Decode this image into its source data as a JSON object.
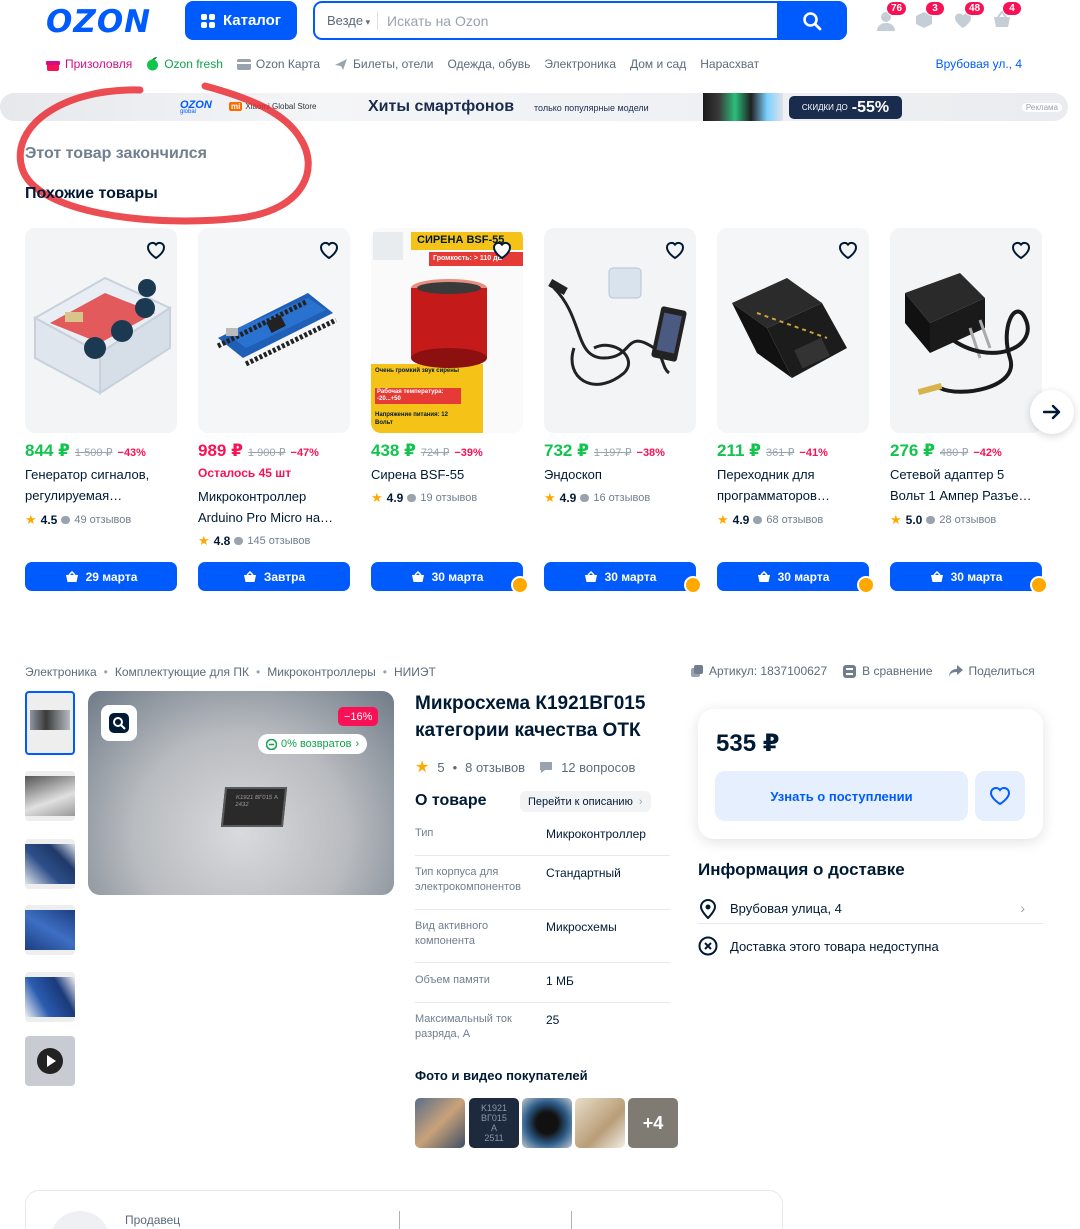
{
  "header": {
    "logo": "OZON",
    "catalog_label": "Каталог",
    "search_scope": "Везде",
    "search_placeholder": "Искать на Ozon",
    "badges": {
      "profile": "76",
      "orders": "3",
      "favorites": "48",
      "cart": "4"
    }
  },
  "nav": {
    "items": [
      "Призоловля",
      "Ozon fresh",
      "Ozon Карта",
      "Билеты, отели",
      "Одежда, обувь",
      "Электроника",
      "Дом и сад",
      "Нарасхват"
    ],
    "address": "Врубовая ул., 4"
  },
  "banner": {
    "brand": "OZON",
    "brand_sub": "global",
    "store": "Xiaomi Global Store",
    "title": "Хиты смартфонов",
    "subtitle": "только популярные модели",
    "discount_prefix": "СКИДКИ ДО",
    "discount_value": "-55%",
    "ad_label": "Реклама"
  },
  "page": {
    "out_of_stock": "Этот товар закончился",
    "similar_title": "Похожие товары"
  },
  "cards": [
    {
      "price": "844 ₽",
      "old_price": "1 500 ₽",
      "discount": "−43%",
      "name": "Генератор сигналов, регулируемая…",
      "rating": "4.5",
      "reviews": "49 отзывов",
      "delivery": "29 марта",
      "price_color": "#10c44c"
    },
    {
      "price": "989 ₽",
      "old_price": "1 900 ₽",
      "discount": "−47%",
      "note": "Осталось 45 шт",
      "name": "Микроконтроллер Arduino Pro Micro на…",
      "rating": "4.8",
      "reviews": "145 отзывов",
      "delivery": "Завтра",
      "price_color": "#f91155"
    },
    {
      "price": "438 ₽",
      "old_price": "724 ₽",
      "discount": "−39%",
      "name": "Сирена BSF-55",
      "rating": "4.9",
      "reviews": "19 отзывов",
      "delivery": "30 марта",
      "price_color": "#10c44c"
    },
    {
      "price": "732 ₽",
      "old_price": "1 197 ₽",
      "discount": "−38%",
      "name": "Эндоскоп",
      "rating": "4.9",
      "reviews": "16 отзывов",
      "delivery": "30 марта",
      "price_color": "#10c44c"
    },
    {
      "price": "211 ₽",
      "old_price": "361 ₽",
      "discount": "−41%",
      "name": "Переходник для программаторов…",
      "rating": "4.9",
      "reviews": "68 отзывов",
      "delivery": "30 марта",
      "price_color": "#10c44c"
    },
    {
      "price": "276 ₽",
      "old_price": "480 ₽",
      "discount": "−42%",
      "name": "Сетевой адаптер 5 Вольт 1 Ампер Разъе…",
      "rating": "5.0",
      "reviews": "28 отзывов",
      "delivery": "30 марта",
      "price_color": "#10c44c"
    }
  ],
  "card_image_text": {
    "siren_title": "СИРЕНА BSF-55",
    "siren_volume": "Громкость: > 110 дБ",
    "siren_f1": "Очень громкий звук сирены",
    "siren_f2": "Рабочая температура: -20...+50",
    "siren_f3": "Напряжение питания: 12 Вольт"
  },
  "breadcrumbs": [
    "Электроника",
    "Комплектующие для ПК",
    "Микроконтроллеры",
    "НИИЭТ"
  ],
  "meta": {
    "article": "Артикул: 1837100627",
    "compare": "В сравнение",
    "share": "Поделиться"
  },
  "product": {
    "discount_badge": "−16%",
    "returns_badge": "0% возвратов",
    "chip_marking": "K1921 ВГ015 A 2432",
    "title": "Микросхема К1921ВГ015 категории качества ОТК",
    "rating": "5",
    "reviews": "8 отзывов",
    "questions": "12 вопросов",
    "about_title": "О товаре",
    "goto_description": "Перейти к описанию",
    "specs": [
      {
        "k": "Тип",
        "v": "Микроконтроллер"
      },
      {
        "k": "Тип корпуса для электрокомпонентов",
        "v": "Стандартный"
      },
      {
        "k": "Вид активного компонента",
        "v": "Микросхемы"
      },
      {
        "k": "Объем памяти",
        "v": "1 МБ"
      },
      {
        "k": "Максимальный ток разряда, А",
        "v": "25"
      }
    ],
    "ugc_title": "Фото и видео покупателей",
    "ugc_more": "+4"
  },
  "pricebox": {
    "price": "535 ₽",
    "notify_label": "Узнать о поступлении"
  },
  "delivery": {
    "title": "Информация о доставке",
    "address": "Врубовая улица, 4",
    "unavailable": "Доставка этого товара недоступна"
  },
  "seller": {
    "label": "Продавец"
  },
  "colors": {
    "brand": "#005bff",
    "sale_pink": "#f91155",
    "price_green": "#10c44c",
    "annotation_red": "#e8262d"
  }
}
